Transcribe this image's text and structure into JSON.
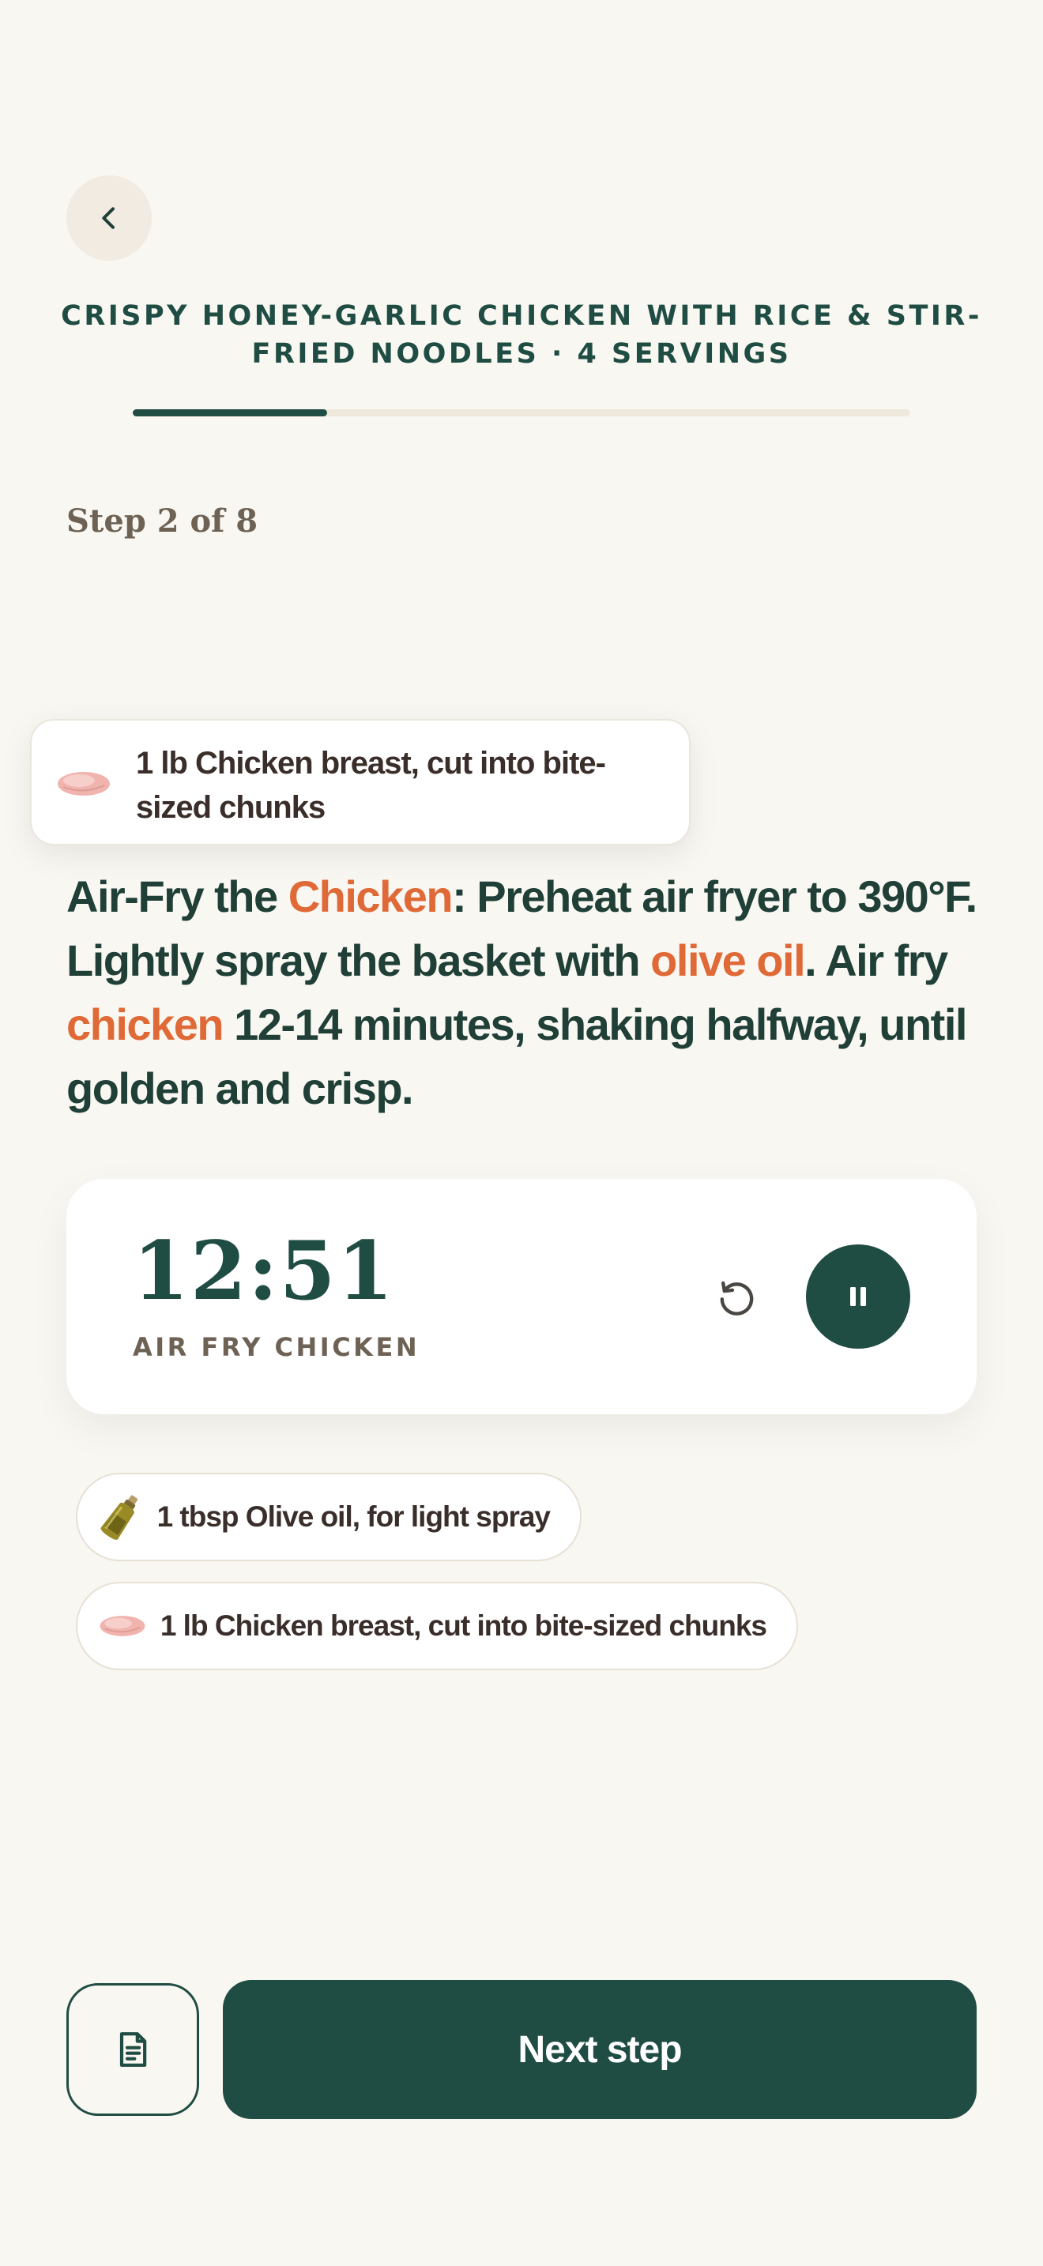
{
  "header": {
    "back_icon": "chevron-left-icon",
    "recipe_title": "CRISPY HONEY-GARLIC CHICKEN WITH RICE & STIR-FRIED NOODLES · 4 SERVINGS",
    "progress_fraction": 0.25
  },
  "step": {
    "label": "Step 2 of 8"
  },
  "tooltip": {
    "icon": "chicken-breast-icon",
    "text": "1 lb Chicken breast, cut into bite-sized chunks"
  },
  "instruction": {
    "part1": "Air-Fry the ",
    "hl1": "Chicken",
    "part2": ": Preheat air fryer to 390°F. Lightly spray the basket with ",
    "hl2": "olive oil",
    "part3": ". Air fry ",
    "hl3": "chicken",
    "part4": " 12-14 minutes, shaking halfway, until golden and crisp."
  },
  "timer": {
    "value": "12:51",
    "label": "AIR FRY CHICKEN",
    "reset_icon": "reset-icon",
    "pause_icon": "pause-icon"
  },
  "ingredients": [
    {
      "icon": "olive-oil-icon",
      "text": "1 tbsp Olive oil, for light spray"
    },
    {
      "icon": "chicken-breast-icon",
      "text": "1 lb Chicken breast, cut into bite-sized chunks"
    }
  ],
  "footer": {
    "notes_icon": "document-icon",
    "next_label": "Next step"
  },
  "colors": {
    "background": "#f9f7f1",
    "primary": "#1f4d43",
    "accent": "#e06a37",
    "muted": "#6e6255"
  }
}
